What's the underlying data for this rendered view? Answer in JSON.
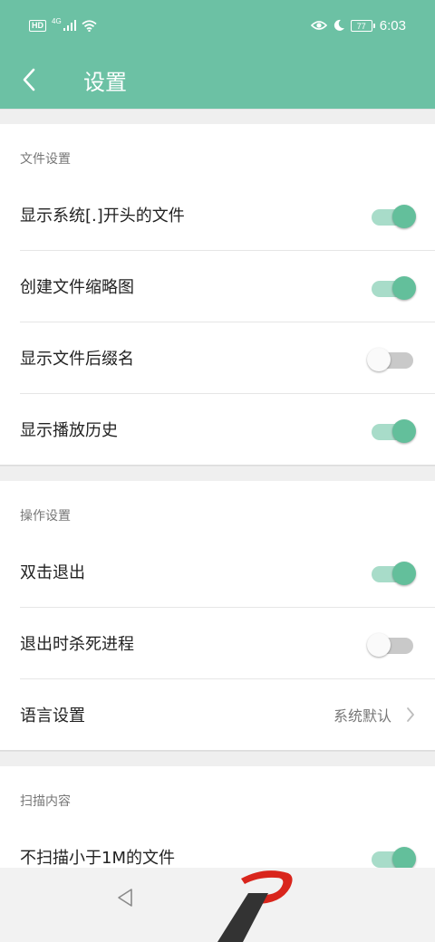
{
  "status_bar": {
    "hd": "HD",
    "network": "4G",
    "battery": "77",
    "time": "6:03",
    "icons": [
      "signal-icon",
      "wifi-icon",
      "eye-icon",
      "moon-icon"
    ]
  },
  "app_bar": {
    "title": "设置",
    "back_icon": "chevron-left-icon"
  },
  "sections": {
    "file": {
      "title": "文件设置",
      "items": [
        {
          "label": "显示系统[.]开头的文件",
          "toggle": true
        },
        {
          "label": "创建文件缩略图",
          "toggle": true
        },
        {
          "label": "显示文件后缀名",
          "toggle": false
        },
        {
          "label": "显示播放历史",
          "toggle": true
        }
      ]
    },
    "operation": {
      "title": "操作设置",
      "items": [
        {
          "label": "双击退出",
          "toggle": true
        },
        {
          "label": "退出时杀死进程",
          "toggle": false
        },
        {
          "label": "语言设置",
          "value": "系统默认"
        }
      ]
    },
    "scan": {
      "title": "扫描内容",
      "items": [
        {
          "label": "不扫描小于1M的文件",
          "toggle": true
        }
      ]
    }
  },
  "colors": {
    "primary": "#6cc1a4",
    "toggle_on_thumb": "#63bf9b",
    "toggle_on_track": "#a8dcc9",
    "toggle_off_track": "#c9c9c9",
    "logo_red": "#d9251c",
    "logo_dark": "#333333"
  }
}
